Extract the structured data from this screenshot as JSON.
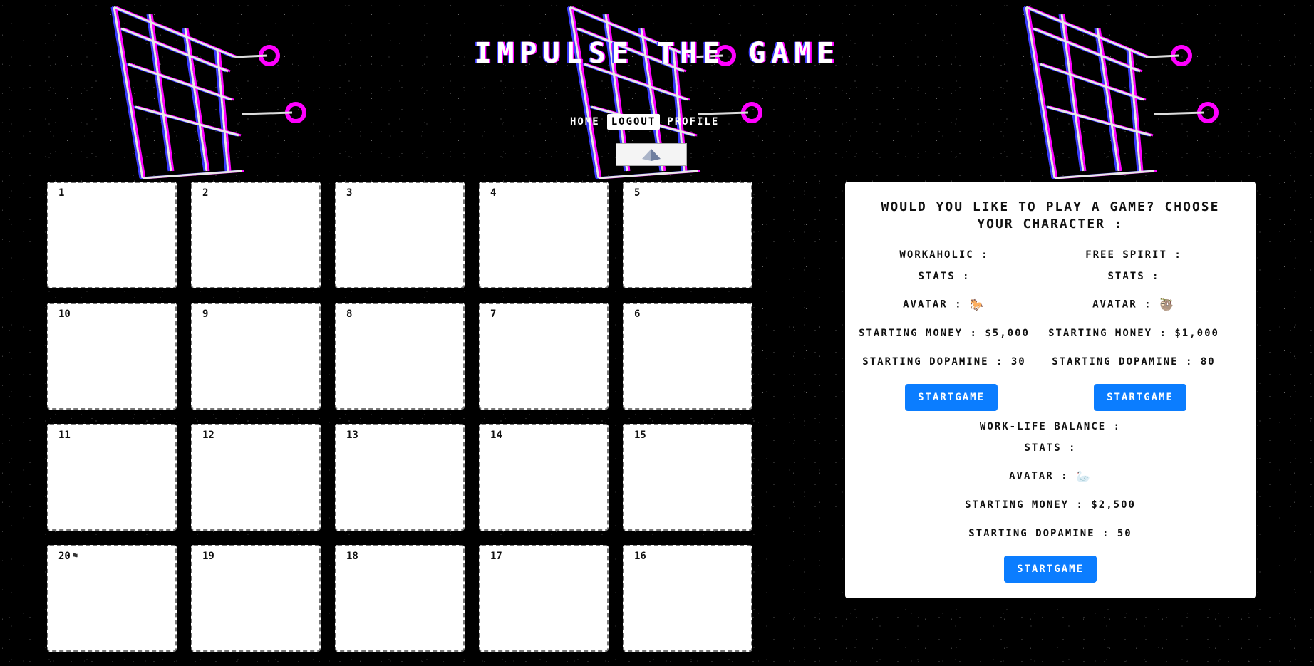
{
  "title": "IMPULSE THE GAME",
  "nav": {
    "home": "HOME",
    "logout": "LOGOUT",
    "profile": "PROFILE"
  },
  "board": {
    "rows": [
      [
        {
          "label": "1"
        },
        {
          "label": "2"
        },
        {
          "label": "3"
        },
        {
          "label": "4"
        },
        {
          "label": "5"
        }
      ],
      [
        {
          "label": "10"
        },
        {
          "label": "9"
        },
        {
          "label": "8"
        },
        {
          "label": "7"
        },
        {
          "label": "6"
        }
      ],
      [
        {
          "label": "11"
        },
        {
          "label": "12"
        },
        {
          "label": "13"
        },
        {
          "label": "14"
        },
        {
          "label": "15"
        }
      ],
      [
        {
          "label": "20",
          "icon": "flag-icon"
        },
        {
          "label": "19"
        },
        {
          "label": "18"
        },
        {
          "label": "17"
        },
        {
          "label": "16"
        }
      ]
    ]
  },
  "panel": {
    "heading": "WOULD YOU LIKE TO PLAY A GAME? CHOOSE YOUR CHARACTER :",
    "characters": [
      {
        "name": "WORKAHOLIC :",
        "stats": "STATS :",
        "avatar_label": "AVATAR :",
        "avatar_icon": "horse-icon",
        "avatar_glyph": "🐎",
        "money": "STARTING MONEY : $5,000",
        "dopamine": "STARTING DOPAMINE : 30",
        "button": "STARTGAME"
      },
      {
        "name": "FREE SPIRIT :",
        "stats": "STATS :",
        "avatar_label": "AVATAR :",
        "avatar_icon": "sloth-icon",
        "avatar_glyph": "🦥",
        "money": "STARTING MONEY : $1,000",
        "dopamine": "STARTING DOPAMINE : 80",
        "button": "STARTGAME"
      },
      {
        "name": "WORK-LIFE BALANCE :",
        "stats": "STATS :",
        "avatar_label": "AVATAR :",
        "avatar_icon": "swan-icon",
        "avatar_glyph": "🦢",
        "money": "STARTING MONEY : $2,500",
        "dopamine": "STARTING DOPAMINE : 50",
        "button": "STARTGAME"
      }
    ]
  },
  "colors": {
    "background": "#000000",
    "button": "#0b7dff",
    "glitch_magenta": "#ff00ff",
    "glitch_blue": "#3b3bff"
  }
}
